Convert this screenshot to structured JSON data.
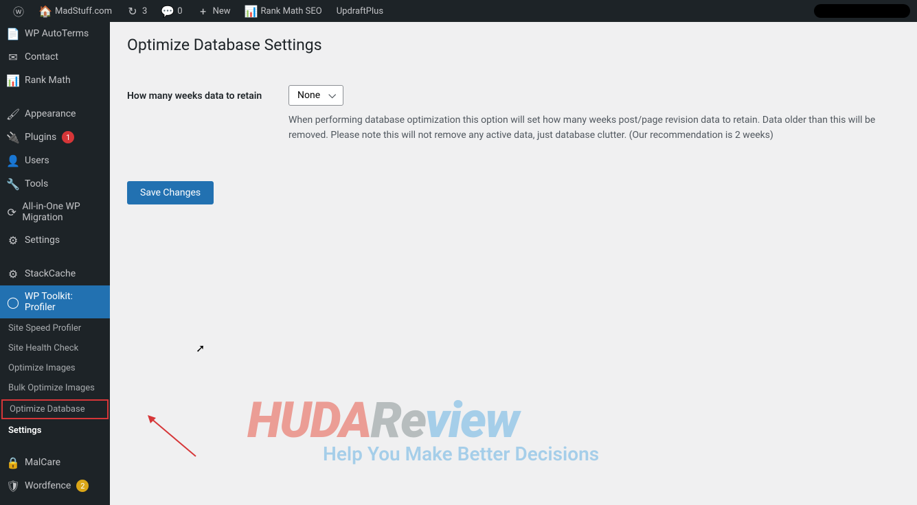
{
  "toolbar": {
    "site_name": "MadStuff.com",
    "refresh_count": "3",
    "comment_count": "0",
    "new_label": "New",
    "rankmath_label": "Rank Math SEO",
    "updraft_label": "UpdraftPlus"
  },
  "sidebar": {
    "items": [
      {
        "label": "WP AutoTerms",
        "icon": "📄"
      },
      {
        "label": "Contact",
        "icon": "✉"
      },
      {
        "label": "Rank Math",
        "icon": "📊"
      }
    ],
    "items2": [
      {
        "label": "Appearance",
        "icon": "🖌"
      },
      {
        "label": "Plugins",
        "icon": "🔌",
        "badge": "1",
        "badge_color": "red"
      },
      {
        "label": "Users",
        "icon": "👤"
      },
      {
        "label": "Tools",
        "icon": "🔧"
      },
      {
        "label": "All-in-One WP Migration",
        "icon": "⟳"
      },
      {
        "label": "Settings",
        "icon": "⚙"
      }
    ],
    "items3": [
      {
        "label": "StackCache",
        "icon": "⚙"
      },
      {
        "label": "WP Toolkit: Profiler",
        "icon": "◯",
        "active": true
      }
    ],
    "submenu": [
      {
        "label": "Site Speed Profiler"
      },
      {
        "label": "Site Health Check"
      },
      {
        "label": "Optimize Images"
      },
      {
        "label": "Bulk Optimize Images"
      },
      {
        "label": "Optimize Database",
        "highlighted": true
      },
      {
        "label": "Settings",
        "current": true
      }
    ],
    "items4": [
      {
        "label": "MalCare",
        "icon": "🔒"
      },
      {
        "label": "Wordfence",
        "icon": "🛡",
        "badge": "2",
        "badge_color": "orange"
      }
    ]
  },
  "page": {
    "title": "Optimize Database Settings",
    "field_label": "How many weeks data to retain",
    "select_value": "None",
    "description": "When performing database optimization this option will set how many weeks post/page revision data to retain. Data older than this will be removed. Please note this will not remove any active data, just database clutter. (Our recommendation is 2 weeks)",
    "save_button": "Save Changes"
  },
  "watermark": {
    "part1": "HUDA",
    "part2": "Re",
    "part3": "view",
    "subtitle": "Help You Make Better Decisions"
  }
}
